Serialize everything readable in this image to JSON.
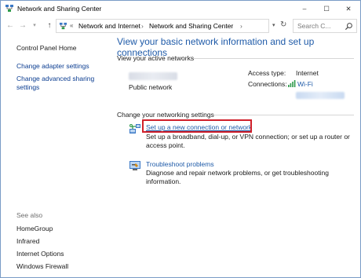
{
  "window": {
    "title": "Network and Sharing Center",
    "controls": {
      "minimize": "–",
      "maximize": "☐",
      "close": "✕"
    }
  },
  "addressbar": {
    "back": "←",
    "forward": "→",
    "recent": "▾",
    "up": "↑",
    "chevron": "«",
    "breadcrumbs": [
      "Network and Internet",
      "Network and Sharing Center"
    ],
    "separator": "›",
    "dropdown": "▾",
    "refresh": "↻",
    "search_placeholder": "Search C..."
  },
  "leftpane": {
    "home": "Control Panel Home",
    "links": [
      "Change adapter settings",
      "Change advanced sharing settings"
    ],
    "see_also_label": "See also",
    "see_also": [
      "HomeGroup",
      "Infrared",
      "Internet Options",
      "Windows Firewall"
    ]
  },
  "main": {
    "title": "View your basic network information and set up connections",
    "active_networks_label": "View your active networks",
    "network_type": "Public network",
    "access_type_label": "Access type:",
    "access_type_value": "Internet",
    "connections_label": "Connections:",
    "connections_value": "Wi-Fi",
    "change_settings_label": "Change your networking settings",
    "tasks": [
      {
        "link": "Set up a new connection or network",
        "desc": "Set up a broadband, dial-up, or VPN connection; or set up a router or access point."
      },
      {
        "link": "Troubleshoot problems",
        "desc": "Diagnose and repair network problems, or get troubleshooting information."
      }
    ]
  },
  "colors": {
    "link": "#1e5aa8",
    "highlight_border": "#d0202a",
    "window_border": "#7a9cc6"
  }
}
